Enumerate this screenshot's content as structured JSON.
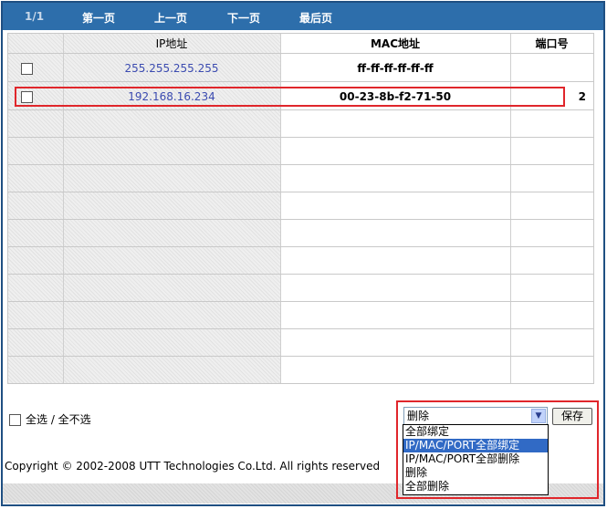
{
  "pager": {
    "current": "1/1",
    "first": "第一页",
    "prev": "上一页",
    "next": "下一页",
    "last": "最后页"
  },
  "table": {
    "headers": {
      "ip": "IP地址",
      "mac": "MAC地址",
      "port": "端口号"
    },
    "rows": [
      {
        "ip": "255.255.255.255",
        "mac": "ff-ff-ff-ff-ff-ff",
        "port": ""
      },
      {
        "ip": "192.168.16.234",
        "mac": "00-23-8b-f2-71-50",
        "port": "2"
      }
    ]
  },
  "select_all_label": "全选 / 全不选",
  "action": {
    "selected": "删除",
    "options": [
      "全部绑定",
      "IP/MAC/PORT全部绑定",
      "IP/MAC/PORT全部删除",
      "删除",
      "全部删除"
    ],
    "highlighted": "IP/MAC/PORT全部绑定",
    "save_label": "保存"
  },
  "copyright": "Copyright © 2002-2008 UTT Technologies Co.Ltd. All rights reserved",
  "colors": {
    "pager_bg": "#2d6eab",
    "highlight_border": "#e0262b",
    "ip_text": "#3b4bb0",
    "option_selected": "#316ac5"
  }
}
